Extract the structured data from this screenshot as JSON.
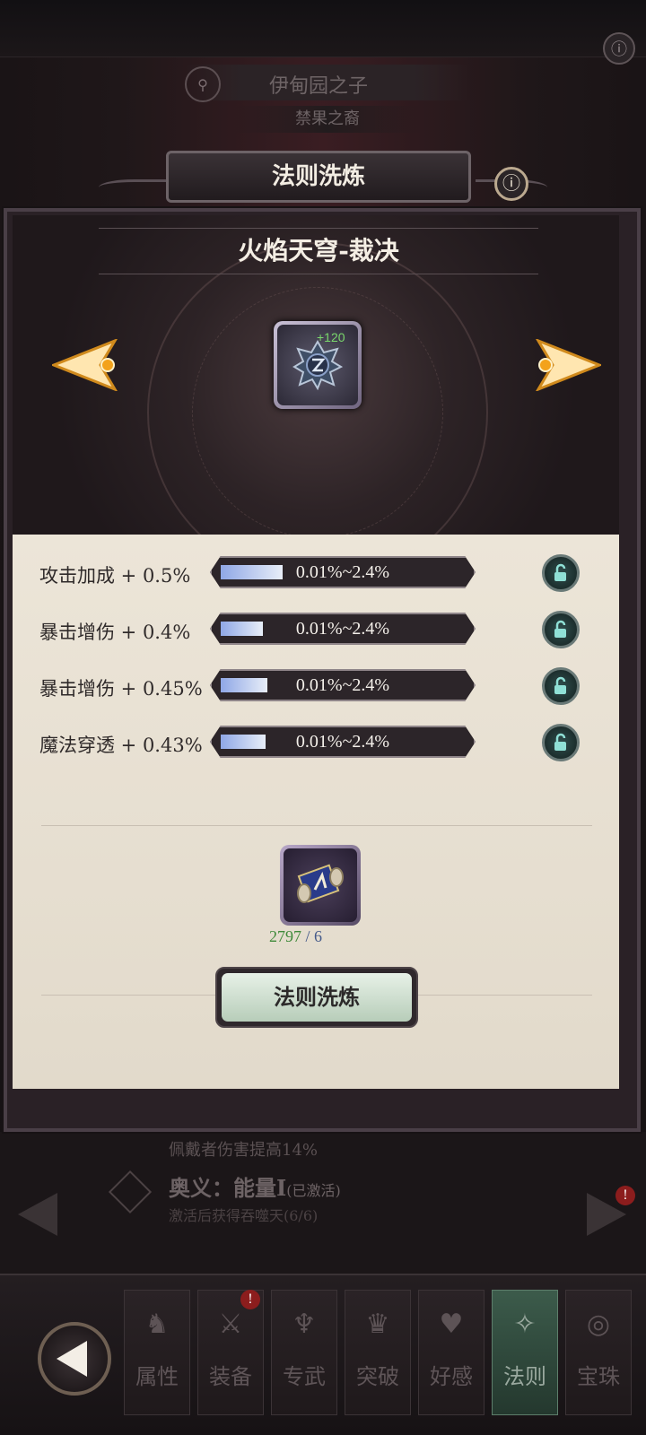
{
  "background": {
    "hero_name": "伊甸园之子",
    "hero_subtitle": "禁果之裔",
    "skill_desc_line1": "佩戴者伤害提高14%",
    "skill_name": "奥义：能量I",
    "skill_status": "(已激活)",
    "skill_desc_line3": "激活后获得吞噬天(6/6)",
    "alert_mark": "!"
  },
  "dialog": {
    "title": "法则洗炼",
    "info_icon": "info-icon",
    "skill_title": "火焰天穹-裁决",
    "rune_bonus": "+120",
    "attributes": [
      {
        "label": "攻击加成 + 0.5%",
        "range": "0.01%~2.4%",
        "fill_pct": 0.25
      },
      {
        "label": "暴击增伤 + 0.4%",
        "range": "0.01%~2.4%",
        "fill_pct": 0.17
      },
      {
        "label": "暴击增伤 + 0.45%",
        "range": "0.01%~2.4%",
        "fill_pct": 0.19
      },
      {
        "label": "魔法穿透 + 0.43%",
        "range": "0.01%~2.4%",
        "fill_pct": 0.18
      }
    ],
    "material_have": "2797",
    "material_need": "/ 6",
    "refine_button": "法则洗炼"
  },
  "nav": {
    "tabs": [
      {
        "label": "属性",
        "icon": "hero-icon"
      },
      {
        "label": "装备",
        "icon": "equipment-icon"
      },
      {
        "label": "专武",
        "icon": "weapon-icon"
      },
      {
        "label": "突破",
        "icon": "breakthrough-icon"
      },
      {
        "label": "好感",
        "icon": "heart-icon"
      },
      {
        "label": "法则",
        "icon": "rune-icon"
      },
      {
        "label": "宝珠",
        "icon": "orb-icon"
      }
    ],
    "active_tab": "法则",
    "alert_mark": "!"
  }
}
